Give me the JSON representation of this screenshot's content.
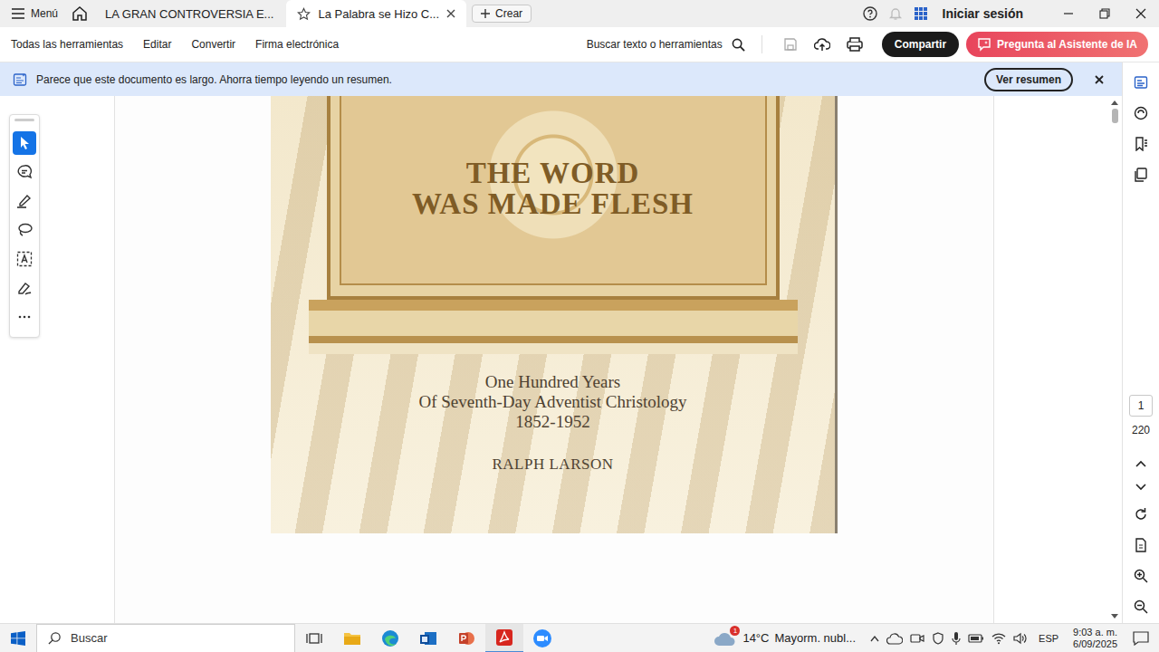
{
  "titlebar": {
    "menu": "Menú",
    "tabs": [
      {
        "label": "LA GRAN CONTROVERSIA E...",
        "selected": false
      },
      {
        "label": "La Palabra se Hizo C...",
        "selected": true
      }
    ],
    "create": "Crear",
    "sign_in": "Iniciar sesión"
  },
  "toolbar": {
    "items": [
      "Todas las herramientas",
      "Editar",
      "Convertir",
      "Firma electrónica"
    ],
    "search": "Buscar texto o herramientas",
    "share": "Compartir",
    "ai_assistant": "Pregunta al Asistente de IA"
  },
  "banner": {
    "text": "Parece que este documento es largo. Ahorra tiempo leyendo un resumen.",
    "button": "Ver resumen"
  },
  "tools": [
    {
      "kind": "select",
      "selected": true
    },
    {
      "kind": "comment",
      "selected": false
    },
    {
      "kind": "highlight",
      "selected": false
    },
    {
      "kind": "lasso",
      "selected": false
    },
    {
      "kind": "text",
      "selected": false
    },
    {
      "kind": "sign",
      "selected": false
    },
    {
      "kind": "more",
      "selected": false
    }
  ],
  "document": {
    "title": [
      "THE WORD",
      "WAS MADE FLESH"
    ],
    "subtitle": [
      "One Hundred Years",
      "Of Seventh-Day Adventist Christology",
      "1852-1952"
    ],
    "author": "RALPH LARSON"
  },
  "page_nav": {
    "current": "1",
    "total": "220"
  },
  "taskbar": {
    "search": "Buscar",
    "weather": {
      "badge": "1",
      "temperature": "14°C",
      "condition": "Mayorm. nubl..."
    },
    "language": "ESP",
    "time": "9:03 a. m.",
    "date": "6/09/2025"
  }
}
